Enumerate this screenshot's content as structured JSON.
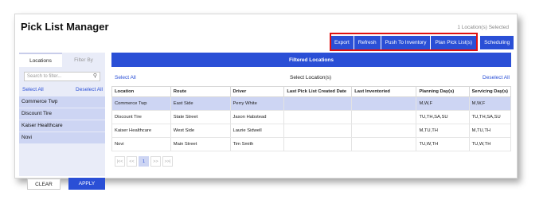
{
  "header": {
    "title": "Pick List Manager",
    "selected_count": "1 Location(s) Selected"
  },
  "toolbar": {
    "buttons": [
      "Export",
      "Refresh",
      "Push To Inventory",
      "Plan Pick List(s)"
    ],
    "scheduling_label": "Scheduling"
  },
  "left_panel": {
    "tabs": [
      "Locations",
      "Filter By"
    ],
    "search_placeholder": "Search to filter...",
    "select_all": "Select All",
    "deselect_all": "Deselect All",
    "items": [
      "Commerce Twp",
      "Discount Tire",
      "Kaiser Healthcare",
      "Novi"
    ],
    "clear_label": "CLEAR",
    "apply_label": "APPLY"
  },
  "right_panel": {
    "header": "Filtered Locations",
    "select_all": "Select All",
    "middle_label": "Select Location(s)",
    "deselect_all": "Deselect All",
    "columns": [
      "Location",
      "Route",
      "Driver",
      "Last Pick List Created Date",
      "Last Inventoried",
      "Planning Day(s)",
      "Servicing Day(s)"
    ],
    "rows": [
      [
        "Commerce Twp",
        "East Side",
        "Perry White",
        "",
        "",
        "M,W,F",
        "M,W,F"
      ],
      [
        "Discount Tire",
        "State Street",
        "Jason Habstead",
        "",
        "",
        "TU,TH,SA,SU",
        "TU,TH,SA,SU"
      ],
      [
        "Kaiser Healthcare",
        "West Side",
        "Laurie Sidwell",
        "",
        "",
        "M,TU,TH",
        "M,TU,TH"
      ],
      [
        "Novi",
        "Main Street",
        "Tim Smith",
        "",
        "",
        "TU,W,TH",
        "TU,W,TH"
      ]
    ],
    "pager": {
      "first": "|<<",
      "prev": "<<",
      "current_page": "1",
      "next": ">>",
      "last": ">>|"
    }
  },
  "colors": {
    "accent": "#2a4fd6",
    "highlight": "#cdd5f3",
    "callout": "#e01010"
  }
}
